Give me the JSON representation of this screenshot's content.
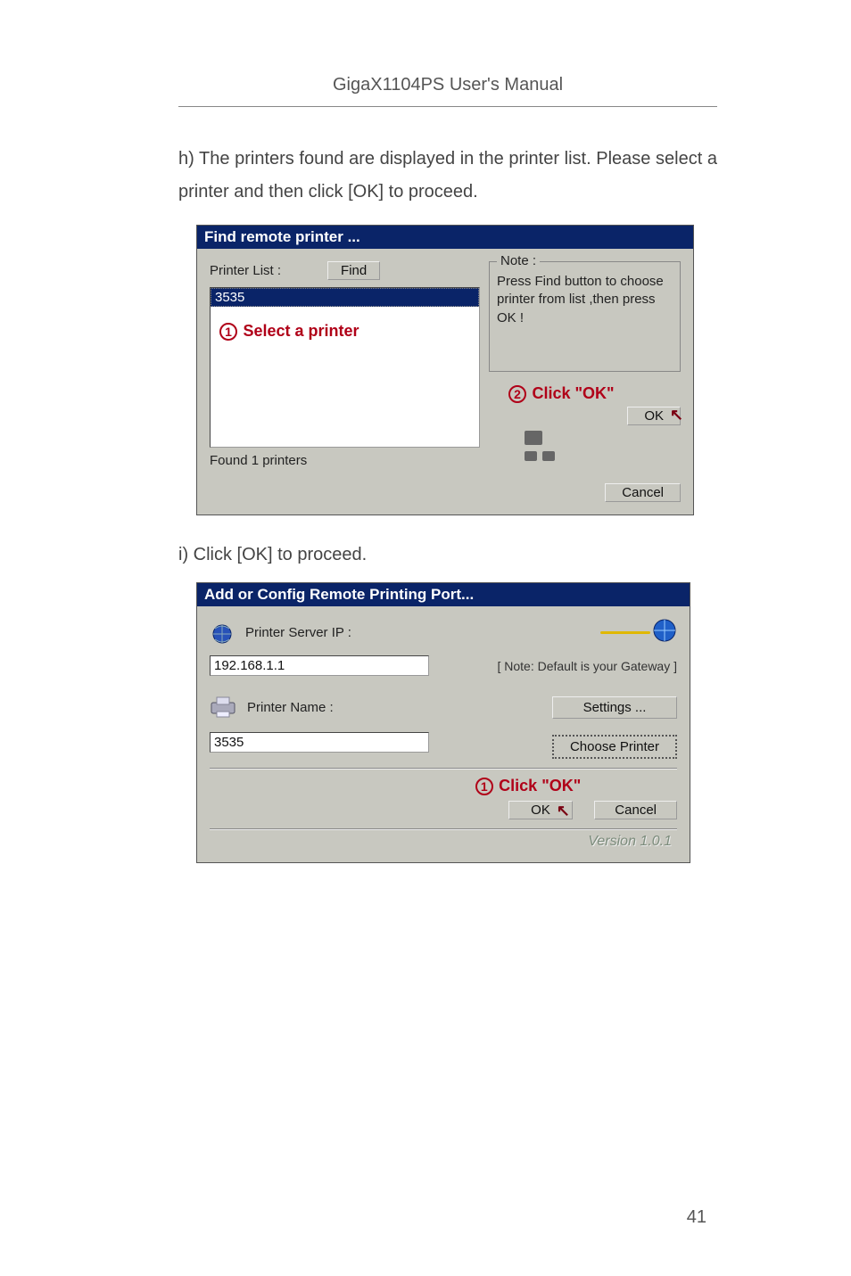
{
  "header": "GigaX1104PS User's Manual",
  "paragraphs": {
    "h": "h) The printers found are displayed in the printer list. Please select a printer and then click [OK]  to proceed.",
    "i": "i) Click [OK]  to proceed."
  },
  "dialog1": {
    "title": "Find remote printer ...",
    "printer_list_label": "Printer List :",
    "find_label": "Find",
    "selected_item": "3535",
    "status": "Found 1 printers",
    "note_legend": "Note :",
    "note_body": "Press Find button to choose printer from list ,then press OK !",
    "ok_label": "OK",
    "cancel_label": "Cancel",
    "anno_select": "Select a printer",
    "anno_click_ok": "Click \"OK\"",
    "circ1": "1",
    "circ2": "2"
  },
  "dialog2": {
    "title": "Add or Config Remote Printing Port...",
    "printer_server_ip_label": "Printer Server IP :",
    "ip_value": "192.168.1.1",
    "gateway_note": "[ Note: Default is your Gateway ]",
    "printer_name_label": "Printer Name :",
    "printer_name_value": "3535",
    "settings_label": "Settings ...",
    "choose_printer_label": "Choose Printer",
    "anno_click_ok": "Click \"OK\"",
    "circ1": "1",
    "ok_label": "OK",
    "cancel_label": "Cancel",
    "version": "Version 1.0.1"
  },
  "page_number": "41"
}
